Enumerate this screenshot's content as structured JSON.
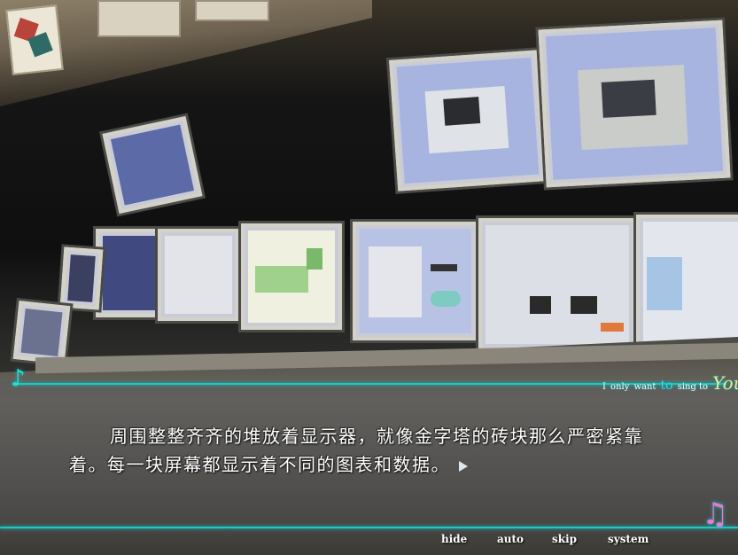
{
  "dialogue": {
    "text": "周围整整齐齐的堆放着显示器，就像金字塔的砖块那么严密紧靠着。每一块屏幕都显示着不同的图表和数据。"
  },
  "tagline": {
    "part1": "I",
    "part2": "only",
    "part3": "want",
    "part4": "to",
    "part5": "sing to",
    "part6": "You"
  },
  "menu": {
    "hide": "hide",
    "auto": "auto",
    "skip": "skip",
    "system": "system"
  },
  "icons": {
    "advance": "triangle-arrow-icon",
    "music_note": "music-note-icon"
  },
  "colors": {
    "accent": "#19c9c2",
    "text": "#ffffff",
    "you_highlight": "#f1e690"
  }
}
